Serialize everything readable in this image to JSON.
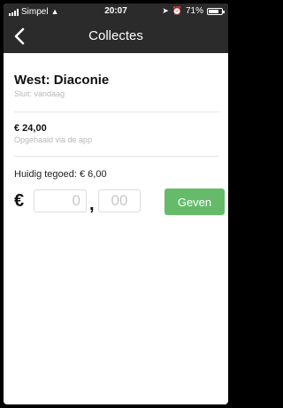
{
  "status_bar": {
    "carrier": "Simpel",
    "time": "20:07",
    "battery": "71%"
  },
  "navbar": {
    "title": "Collectes",
    "back_icon": "chevron-left-icon"
  },
  "collection": {
    "title": "West: Diaconie",
    "closing": "Sluit: vandaag",
    "amount": "€ 24,00",
    "amount_caption": "Opgehaald via de app"
  },
  "donate": {
    "balance": "Huidig tegoed: € 6,00",
    "currency_symbol": "€",
    "euros_placeholder": "0",
    "decimal_separator": ",",
    "cents_placeholder": "00",
    "button_label": "Geven",
    "button_color": "#66bb6a"
  }
}
